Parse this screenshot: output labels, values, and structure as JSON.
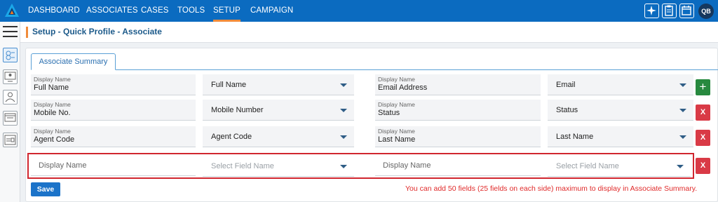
{
  "brand": {
    "logo_icon": "app-logo-icon"
  },
  "nav": {
    "items": [
      {
        "label": "DASHBOARD"
      },
      {
        "label": "ASSOCIATES"
      },
      {
        "label": "CASES"
      },
      {
        "label": "TOOLS"
      },
      {
        "label": "SETUP",
        "active": true
      },
      {
        "label": "CAMPAIGN"
      }
    ],
    "tools": [
      "sparkle-icon",
      "clipboard-icon",
      "calendar-icon"
    ],
    "user_initials": "QB"
  },
  "rail": {
    "icons": [
      "menu-icon",
      "profile-list-icon",
      "monitor-user-icon",
      "contact-card-icon",
      "screen-settings-icon",
      "address-card-icon"
    ]
  },
  "page": {
    "title": "Setup - Quick Profile - Associate"
  },
  "tabs": {
    "active": "Associate Summary"
  },
  "rows": [
    {
      "left_label": "Display Name",
      "left_value": "Full Name",
      "left_field": "Full Name",
      "right_label": "Display Name",
      "right_value": "Email Address",
      "right_field": "Email",
      "action": "+"
    },
    {
      "left_label": "Display Name",
      "left_value": "Mobile No.",
      "left_field": "Mobile Number",
      "right_label": "Display Name",
      "right_value": "Status",
      "right_field": "Status",
      "action": "X"
    },
    {
      "left_label": "Display Name",
      "left_value": "Agent Code",
      "left_field": "Agent Code",
      "right_label": "Display Name",
      "right_value": "Last Name",
      "right_field": "Last Name",
      "action": "X"
    }
  ],
  "new_row": {
    "left_placeholder": "Display Name",
    "left_select": "Select Field Name",
    "right_placeholder": "Display Name",
    "right_select": "Select Field Name",
    "action": "X"
  },
  "save_label": "Save",
  "note": "You can add 50 fields (25 fields on each side) maximum to display in Associate Summary.",
  "colors": {
    "nav_bg": "#0b6bc0",
    "accent": "#f08b3a",
    "add": "#27893f",
    "delete": "#d93a46",
    "warning": "#e02a2a"
  }
}
